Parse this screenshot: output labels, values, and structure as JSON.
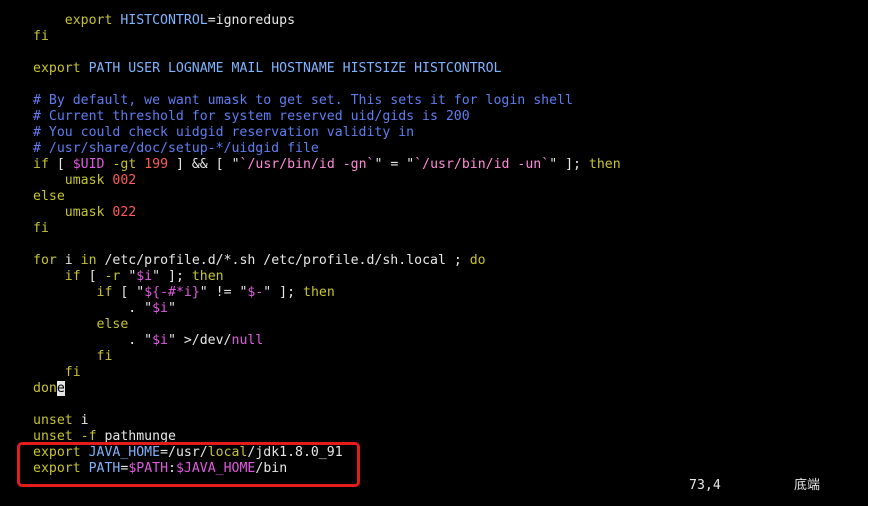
{
  "colors": {
    "background": "#000000",
    "default_text": "#e6e6e6",
    "keyword": "#c7c42f",
    "variable": "#7fb3ff",
    "comment": "#5f7df0",
    "number": "#ff5a5a",
    "string": "#ff8ad8",
    "special": "#e05ae0",
    "highlight_box": "#e21b1b"
  },
  "status": {
    "position": "73,4",
    "scroll": "底端"
  },
  "lines": [
    [
      [
        "tx",
        "    "
      ],
      [
        "kw",
        "export"
      ],
      [
        "tx",
        " "
      ],
      [
        "vr",
        "HISTCONTROL"
      ],
      [
        "tx",
        "=ignoredups"
      ]
    ],
    [
      [
        "kw",
        "fi"
      ]
    ],
    [],
    [
      [
        "kw",
        "export"
      ],
      [
        "tx",
        " "
      ],
      [
        "vr",
        "PATH USER LOGNAME MAIL HOSTNAME HISTSIZE HISTCONTROL"
      ]
    ],
    [],
    [
      [
        "cm",
        "# By default, we want umask to get set. This sets it for login shell"
      ]
    ],
    [
      [
        "cm",
        "# Current threshold for system reserved uid/gids is 200"
      ]
    ],
    [
      [
        "cm",
        "# You could check uidgid reservation validity in"
      ]
    ],
    [
      [
        "cm",
        "# /usr/share/doc/setup-*/uidgid file"
      ]
    ],
    [
      [
        "kw",
        "if"
      ],
      [
        "tx",
        " [ "
      ],
      [
        "sp",
        "$UID"
      ],
      [
        "tx",
        " "
      ],
      [
        "kw",
        "-gt"
      ],
      [
        "tx",
        " "
      ],
      [
        "nm",
        "199"
      ],
      [
        "tx",
        " ] && [ \""
      ],
      [
        "st",
        "`/usr/bin/id -gn`"
      ],
      [
        "tx",
        "\" = \""
      ],
      [
        "st",
        "`/usr/bin/id -un`"
      ],
      [
        "tx",
        "\" ]; "
      ],
      [
        "kw",
        "then"
      ]
    ],
    [
      [
        "tx",
        "    "
      ],
      [
        "kw",
        "umask"
      ],
      [
        "tx",
        " "
      ],
      [
        "nm",
        "002"
      ]
    ],
    [
      [
        "kw",
        "else"
      ]
    ],
    [
      [
        "tx",
        "    "
      ],
      [
        "kw",
        "umask"
      ],
      [
        "tx",
        " "
      ],
      [
        "nm",
        "022"
      ]
    ],
    [
      [
        "kw",
        "fi"
      ]
    ],
    [],
    [
      [
        "kw",
        "for"
      ],
      [
        "tx",
        " i "
      ],
      [
        "kw",
        "in"
      ],
      [
        "tx",
        " /etc/profile.d/*.sh /etc/profile.d/sh.local ; "
      ],
      [
        "kw",
        "do"
      ]
    ],
    [
      [
        "tx",
        "    "
      ],
      [
        "kw",
        "if"
      ],
      [
        "tx",
        " [ "
      ],
      [
        "kw",
        "-r"
      ],
      [
        "tx",
        " \""
      ],
      [
        "sp",
        "$i"
      ],
      [
        "tx",
        "\" ]; "
      ],
      [
        "kw",
        "then"
      ]
    ],
    [
      [
        "tx",
        "        "
      ],
      [
        "kw",
        "if"
      ],
      [
        "tx",
        " [ \""
      ],
      [
        "sp",
        "${-#*i}"
      ],
      [
        "tx",
        "\" != \""
      ],
      [
        "sp",
        "$-"
      ],
      [
        "tx",
        "\" ]; "
      ],
      [
        "kw",
        "then"
      ]
    ],
    [
      [
        "tx",
        "            . \""
      ],
      [
        "sp",
        "$i"
      ],
      [
        "tx",
        "\""
      ]
    ],
    [
      [
        "tx",
        "        "
      ],
      [
        "kw",
        "else"
      ]
    ],
    [
      [
        "tx",
        "            . \""
      ],
      [
        "sp",
        "$i"
      ],
      [
        "tx",
        "\" >/dev/"
      ],
      [
        "sp",
        "null"
      ]
    ],
    [
      [
        "tx",
        "        "
      ],
      [
        "kw",
        "fi"
      ]
    ],
    [
      [
        "tx",
        "    "
      ],
      [
        "kw",
        "fi"
      ]
    ],
    [
      [
        "kw",
        "don"
      ],
      [
        "cursor",
        "e"
      ]
    ],
    [],
    [
      [
        "kw",
        "unset"
      ],
      [
        "tx",
        " i"
      ]
    ],
    [
      [
        "kw",
        "unset"
      ],
      [
        "tx",
        " "
      ],
      [
        "kw",
        "-f"
      ],
      [
        "tx",
        " pathmunge"
      ]
    ],
    [
      [
        "kw",
        "export"
      ],
      [
        "tx",
        " "
      ],
      [
        "vr",
        "JAVA_HOME"
      ],
      [
        "tx",
        "=/usr/"
      ],
      [
        "kw",
        "local"
      ],
      [
        "tx",
        "/jdk1.8.0_91"
      ]
    ],
    [
      [
        "kw",
        "export"
      ],
      [
        "tx",
        " "
      ],
      [
        "vr",
        "PATH"
      ],
      [
        "tx",
        "="
      ],
      [
        "sp",
        "$PATH"
      ],
      [
        "tx",
        ":"
      ],
      [
        "sp",
        "$JAVA_HOME"
      ],
      [
        "tx",
        "/bin"
      ]
    ]
  ]
}
